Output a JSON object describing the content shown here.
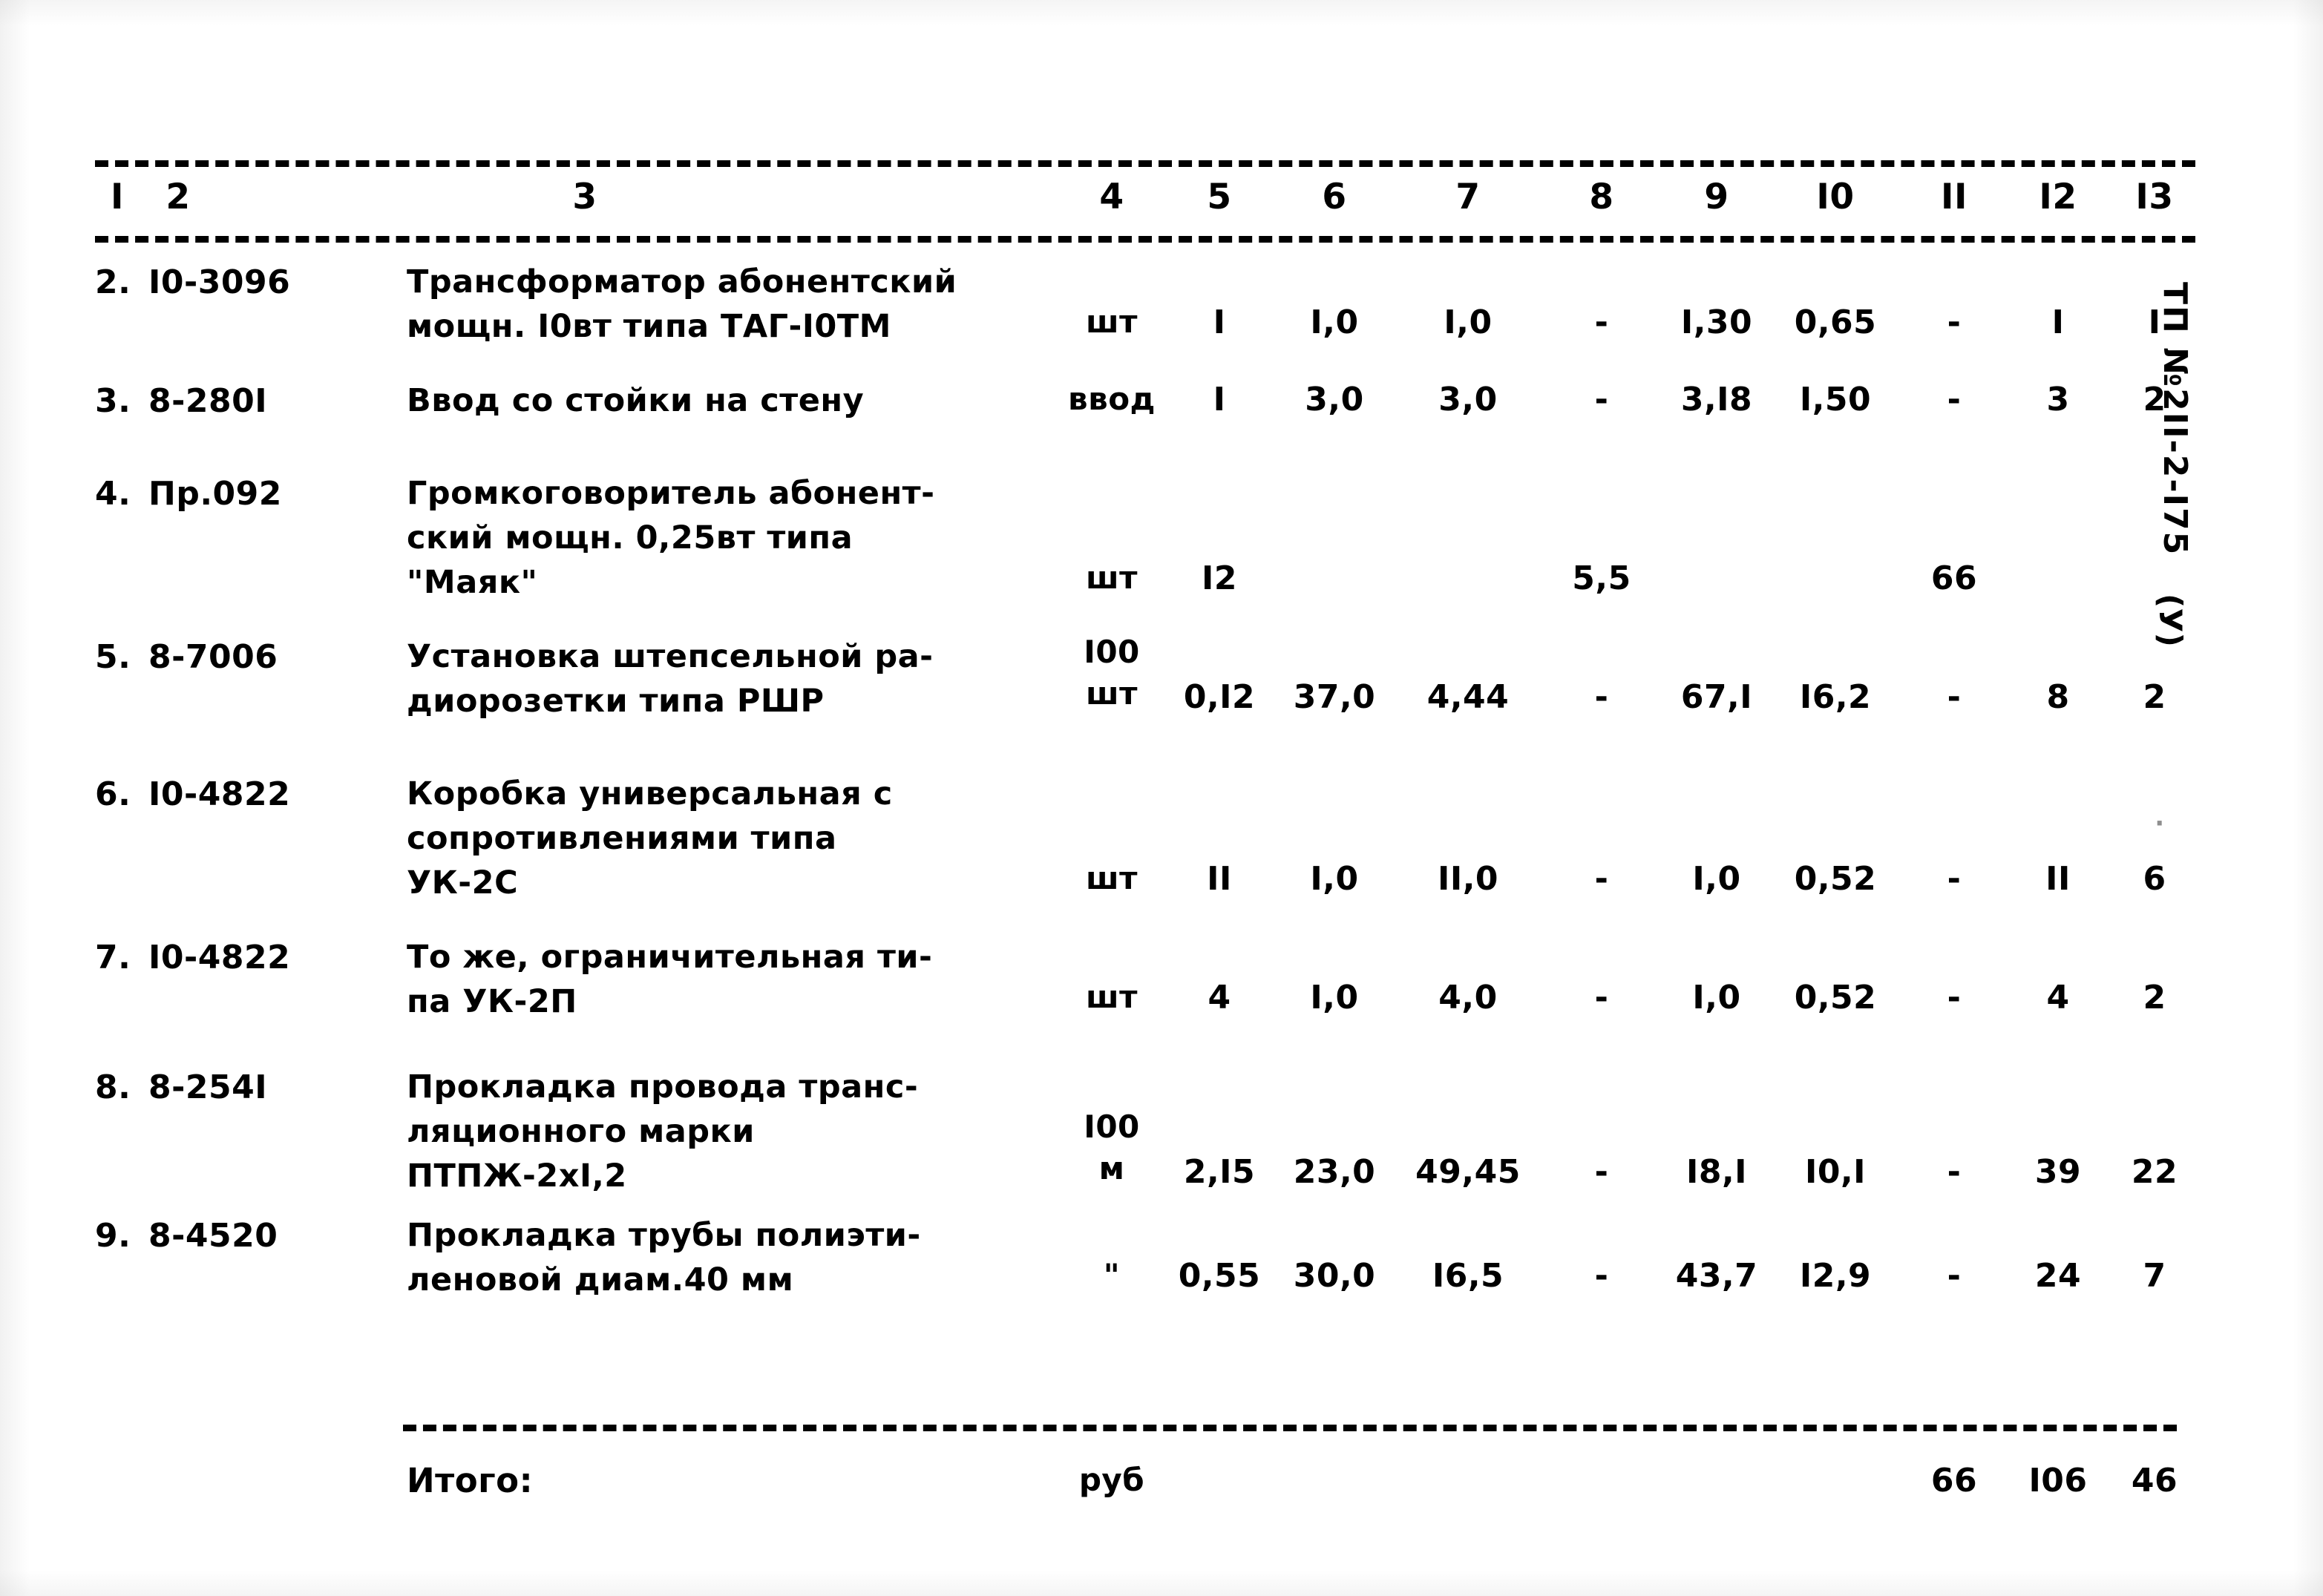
{
  "document": {
    "side_stamp": "ТП №2II-2-I75",
    "side_stamp_suffix": "(У)",
    "side_smudge": "·"
  },
  "table": {
    "header": [
      "I",
      "2",
      "3",
      "4",
      "5",
      "6",
      "7",
      "8",
      "9",
      "I0",
      "II",
      "I2",
      "I3"
    ],
    "rows": [
      {
        "num": "2.",
        "code": "I0-3096",
        "desc": [
          "Трансформатор абонентский",
          "мощн. I0вт типа ТАГ-I0ТМ"
        ],
        "unit": [
          "шт"
        ],
        "c5": "I",
        "c6": "I,0",
        "c7": "I,0",
        "c8": "-",
        "c9": "I,30",
        "c10": "0,65",
        "c11": "-",
        "c12": "I",
        "c13": "I"
      },
      {
        "num": "3.",
        "code": "8-280I",
        "desc": [
          "Ввод со стойки на стену"
        ],
        "unit": [
          "ввод"
        ],
        "c5": "I",
        "c6": "3,0",
        "c7": "3,0",
        "c8": "-",
        "c9": "3,I8",
        "c10": "I,50",
        "c11": "-",
        "c12": "3",
        "c13": "2"
      },
      {
        "num": "4.",
        "code": "Пр.092",
        "desc": [
          "Громкоговоритель абонент-",
          "ский мощн. 0,25вт типа",
          "\"Маяк\""
        ],
        "unit": [
          "шт"
        ],
        "c5": "I2",
        "c6": "",
        "c7": "",
        "c8": "5,5",
        "c9": "",
        "c10": "",
        "c11": "66",
        "c12": "",
        "c13": ""
      },
      {
        "num": "5.",
        "code": "8-7006",
        "desc": [
          "Установка штепсельной ра-",
          "диорозетки типа РШР"
        ],
        "unit": [
          "I00",
          "шт"
        ],
        "c5": "0,I2",
        "c6": "37,0",
        "c7": "4,44",
        "c8": "-",
        "c9": "67,I",
        "c10": "I6,2",
        "c11": "-",
        "c12": "8",
        "c13": "2"
      },
      {
        "num": "6.",
        "code": "I0-4822",
        "desc": [
          "Коробка универсальная с",
          "сопротивлениями типа",
          "УК-2С"
        ],
        "unit": [
          "шт"
        ],
        "c5": "II",
        "c6": "I,0",
        "c7": "II,0",
        "c8": "-",
        "c9": "I,0",
        "c10": "0,52",
        "c11": "-",
        "c12": "II",
        "c13": "6"
      },
      {
        "num": "7.",
        "code": "I0-4822",
        "desc": [
          "То же, ограничительная ти-",
          "па УК-2П"
        ],
        "unit": [
          "шт"
        ],
        "c5": "4",
        "c6": "I,0",
        "c7": "4,0",
        "c8": "-",
        "c9": "I,0",
        "c10": "0,52",
        "c11": "-",
        "c12": "4",
        "c13": "2"
      },
      {
        "num": "8.",
        "code": "8-254I",
        "desc": [
          "Прокладка провода транс-",
          "ляционного марки",
          "ПТПЖ-2хI,2"
        ],
        "unit": [
          "I00",
          "м"
        ],
        "c5": "2,I5",
        "c6": "23,0",
        "c7": "49,45",
        "c8": "-",
        "c9": "I8,I",
        "c10": "I0,I",
        "c11": "-",
        "c12": "39",
        "c13": "22"
      },
      {
        "num": "9.",
        "code": "8-4520",
        "desc": [
          "Прокладка трубы полиэти-",
          "леновой диам.40 мм"
        ],
        "unit": [
          "\""
        ],
        "c5": "0,55",
        "c6": "30,0",
        "c7": "I6,5",
        "c8": "-",
        "c9": "43,7",
        "c10": "I2,9",
        "c11": "-",
        "c12": "24",
        "c13": "7"
      }
    ],
    "totals": {
      "label": "Итого:",
      "unit": "руб",
      "c11": "66",
      "c12": "I06",
      "c13": "46"
    }
  }
}
